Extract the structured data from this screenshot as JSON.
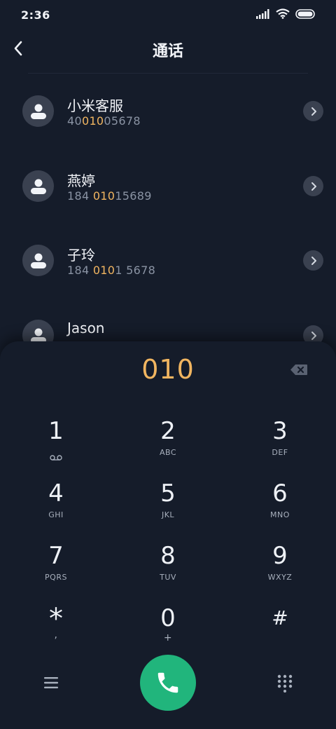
{
  "status_bar": {
    "time": "2:36",
    "icons": [
      "signal-icon",
      "wifi-icon",
      "battery-icon"
    ]
  },
  "header": {
    "title": "通话",
    "back_icon": "back-chevron-icon"
  },
  "contacts": [
    {
      "name": "小米客服",
      "phone_parts": [
        "40",
        "010",
        "05678"
      ]
    },
    {
      "name": "燕婷",
      "phone_parts": [
        "184 ",
        "010",
        "15689"
      ]
    },
    {
      "name": "子玲",
      "phone_parts": [
        "184 ",
        "010",
        "1 5678"
      ]
    },
    {
      "name": "Jason",
      "phone_parts": [
        "",
        "",
        ""
      ]
    }
  ],
  "dialer": {
    "number": "010",
    "keys": [
      {
        "digit": "1",
        "sub": "",
        "sub_icon": "voicemail-icon"
      },
      {
        "digit": "2",
        "sub": "ABC"
      },
      {
        "digit": "3",
        "sub": "DEF"
      },
      {
        "digit": "4",
        "sub": "GHI"
      },
      {
        "digit": "5",
        "sub": "JKL"
      },
      {
        "digit": "6",
        "sub": "MNO"
      },
      {
        "digit": "7",
        "sub": "PQRS"
      },
      {
        "digit": "8",
        "sub": "TUV"
      },
      {
        "digit": "9",
        "sub": "WXYZ"
      },
      {
        "digit": "*",
        "sub": ","
      },
      {
        "digit": "0",
        "sub": "+"
      },
      {
        "digit": "#",
        "sub": ""
      }
    ]
  },
  "colors": {
    "background": "#151c2a",
    "highlight": "#f1b560",
    "call_button": "#21b57c",
    "avatar_bg": "#3a4150"
  }
}
